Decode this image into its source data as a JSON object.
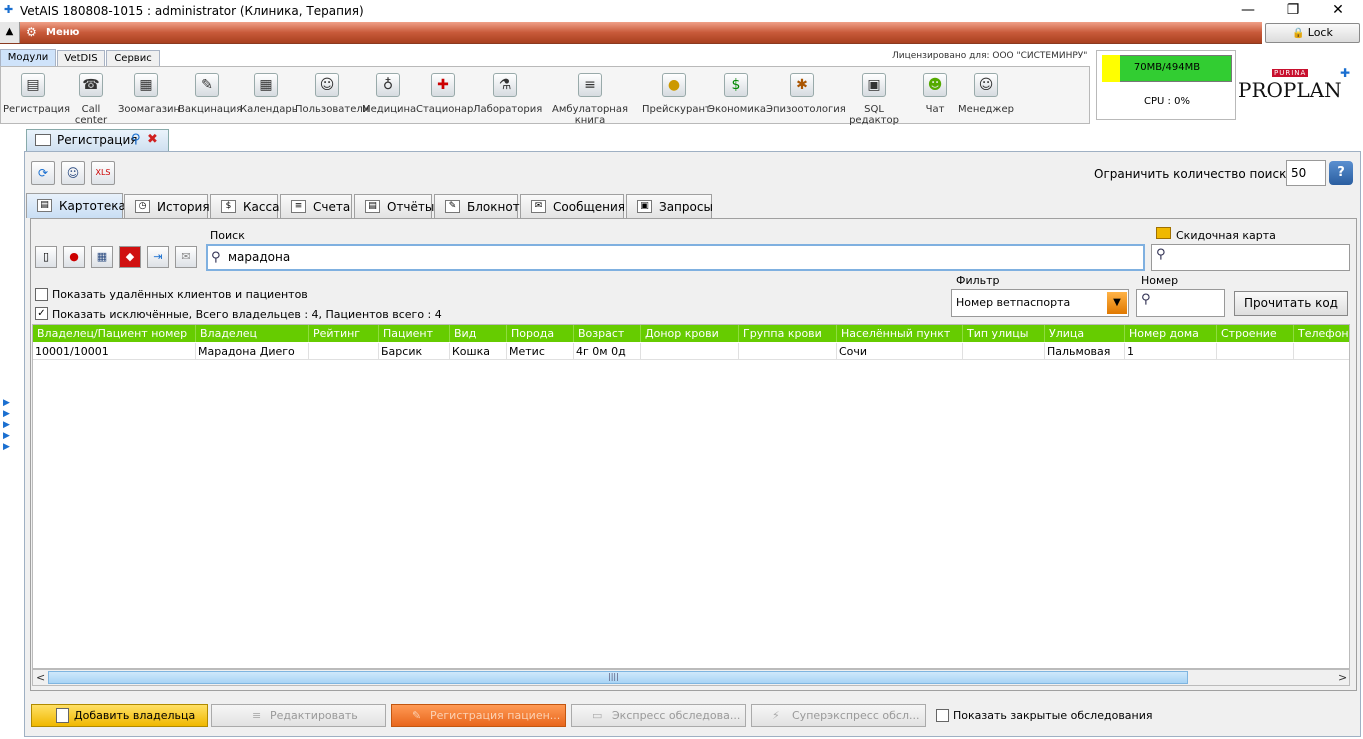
{
  "window": {
    "title": "VetAIS 180808-1015 : administrator (Клиника, Терапия)",
    "minimize": "—",
    "maximize": "❐",
    "close": "✕"
  },
  "menu": {
    "label": "Меню",
    "lock": "Lock"
  },
  "module_tabs": [
    "Модули",
    "VetDIS",
    "Сервис"
  ],
  "license": "Лицензировано для: ООО \"СИСТЕМИНРУ\"",
  "modules": [
    {
      "label": "Регистрация",
      "icon": "registration-icon"
    },
    {
      "label": "Call center",
      "icon": "call-center-icon"
    },
    {
      "label": "Зоомагазин",
      "icon": "pet-shop-icon"
    },
    {
      "label": "Вакцинация",
      "icon": "syringe-icon"
    },
    {
      "label": "Календарь",
      "icon": "calendar-icon"
    },
    {
      "label": "Пользователи",
      "icon": "users-icon"
    },
    {
      "label": "Медицина",
      "icon": "stethoscope-icon"
    },
    {
      "label": "Стационар",
      "icon": "hospital-icon"
    },
    {
      "label": "Лаборатория",
      "icon": "flask-icon"
    },
    {
      "label": "Амбулаторная книга",
      "icon": "book-icon"
    },
    {
      "label": "Прейскурант",
      "icon": "coins-icon"
    },
    {
      "label": "Экономика",
      "icon": "money-icon"
    },
    {
      "label": "Эпизоотология",
      "icon": "bug-icon"
    },
    {
      "label": "SQL редактор",
      "icon": "sql-icon"
    },
    {
      "label": "Чат",
      "icon": "chat-icon"
    },
    {
      "label": "Менеджер",
      "icon": "manager-icon"
    }
  ],
  "system": {
    "memory": "70MB/494MB",
    "memory_fraction": 0.14,
    "cpu": "CPU : 0%"
  },
  "brand": {
    "purina": "PURINA",
    "proplan": "PROPLAN"
  },
  "doc_tab": {
    "label": "Регистрация"
  },
  "limit": {
    "label": "Ограничить количество поиска на",
    "value": "50",
    "help": "?"
  },
  "sub_tabs": [
    "Картотека",
    "История",
    "Касса",
    "Счета",
    "Отчёты",
    "Блокнот",
    "Сообщения",
    "Запросы"
  ],
  "search": {
    "label": "Поиск",
    "value": "марадона"
  },
  "discount": {
    "label": "Скидочная карта",
    "value": ""
  },
  "options": {
    "show_deleted": "Показать удалённых клиентов и пациентов",
    "show_excluded": "Показать исключённые, Всего владельцев : 4, Пациентов всего : 4"
  },
  "filter": {
    "label": "Фильтр",
    "value": "Номер ветпаспорта"
  },
  "number": {
    "label": "Номер",
    "value": ""
  },
  "read_code": "Прочитать код",
  "table": {
    "columns": [
      "Владелец/Пациент номер",
      "Владелец",
      "Рейтинг",
      "Пациент",
      "Вид",
      "Порода",
      "Возраст",
      "Донор крови",
      "Группа крови",
      "Населённый пункт",
      "Тип улицы",
      "Улица",
      "Номер дома",
      "Строение",
      "Телефон"
    ],
    "rows": [
      [
        "10001/10001",
        "Марадона Диего",
        "",
        "Барсик",
        "Кошка",
        "Метис",
        "4г 0м 0д",
        "",
        "",
        "Сочи",
        "",
        "Пальмовая",
        "1",
        "",
        ""
      ]
    ]
  },
  "scroll": {
    "grip": "||||",
    "left": "<",
    "right": ">"
  },
  "bottom": {
    "add_owner": "Добавить владельца",
    "edit": "Редактировать",
    "register_patient": "Регистрация пациен...",
    "express": "Экспресс обследова...",
    "superexpress": "Суперэкспресс обсл...",
    "show_closed": "Показать закрытые обследования"
  }
}
